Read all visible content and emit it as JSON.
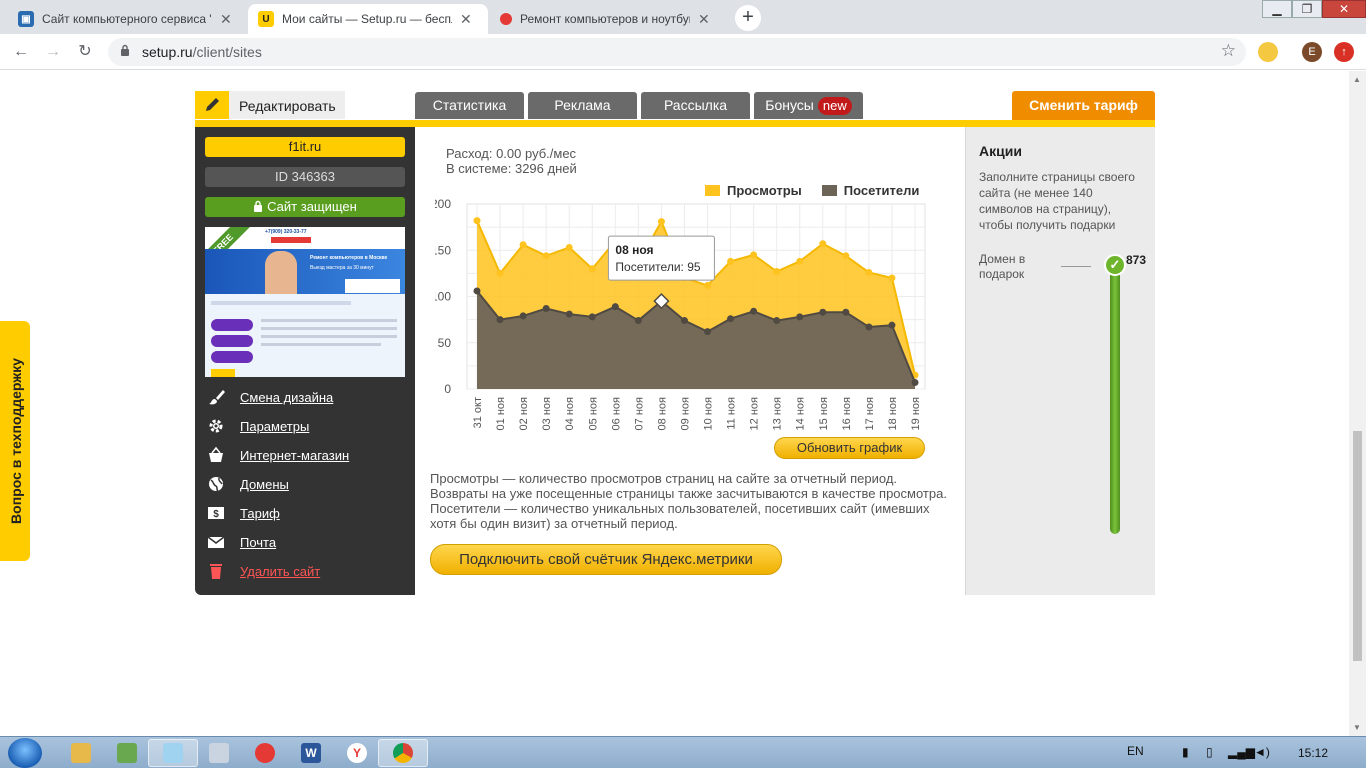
{
  "browser": {
    "tabs": [
      {
        "title": "Сайт компьютерного сервиса \"F",
        "active": false
      },
      {
        "title": "Мои сайты — Setup.ru — беспл",
        "active": true
      },
      {
        "title": "Ремонт компьютеров и ноутбук",
        "active": false
      }
    ],
    "url_host": "setup.ru",
    "url_path": "/client/sites",
    "profile_initial": "E"
  },
  "support_tab": "Вопрос в техподдержку",
  "topbar": {
    "edit_label": "Редактировать",
    "tabs": [
      "Статистика",
      "Реклама",
      "Рассылка",
      "Бонусы"
    ],
    "new_badge": "new",
    "tariff_button": "Сменить тариф"
  },
  "sidebar": {
    "domain": "f1it.ru",
    "site_id": "ID 346363",
    "secure_label": "Сайт защищен",
    "thumb_badge": "FREE",
    "thumb_phone": "+7(909) 320-33-77",
    "thumb_headline": "Ремонт компьютеров в Москве",
    "thumb_subline": "Выезд мастера за 30 минут",
    "menu": [
      {
        "label": "Смена дизайна",
        "icon": "brush-icon"
      },
      {
        "label": "Параметры",
        "icon": "gear-icon"
      },
      {
        "label": "Интернет-магазин",
        "icon": "basket-icon"
      },
      {
        "label": "Домены",
        "icon": "globe-icon"
      },
      {
        "label": "Тариф",
        "icon": "dollar-icon"
      },
      {
        "label": "Почта",
        "icon": "envelope-icon"
      },
      {
        "label": "Удалить сайт",
        "icon": "trash-icon"
      }
    ]
  },
  "stats": {
    "expense": "Расход: 0.00 руб./мес",
    "in_system": "В системе: 3296 дней",
    "refresh_button": "Обновить график",
    "description": "Просмотры — количество просмотров страниц на сайте за отчетный период. Возвраты на уже посещенные страницы также засчитываются в качестве просмотра. Посетители — количество уникальных пользователей, посетивших сайт (имевших хотя бы один визит) за отчетный период.",
    "metrika_button": "Подключить свой счётчик Яндекс.метрики"
  },
  "chart_data": {
    "type": "area",
    "x": [
      "31 окт",
      "01 ноя",
      "02 ноя",
      "03 ноя",
      "04 ноя",
      "05 ноя",
      "06 ноя",
      "07 ноя",
      "08 ноя",
      "09 ноя",
      "10 ноя",
      "11 ноя",
      "12 ноя",
      "13 ноя",
      "14 ноя",
      "15 ноя",
      "16 ноя",
      "17 ноя",
      "18 ноя",
      "19 ноя"
    ],
    "series": [
      {
        "name": "Просмотры",
        "color": "#ffc31f",
        "values": [
          182,
          125,
          156,
          144,
          153,
          130,
          160,
          137,
          181,
          120,
          112,
          138,
          145,
          127,
          138,
          157,
          144,
          126,
          120,
          15
        ]
      },
      {
        "name": "Посетители",
        "color": "#6d6458",
        "values": [
          106,
          75,
          79,
          87,
          81,
          78,
          89,
          74,
          95,
          74,
          62,
          76,
          84,
          74,
          78,
          83,
          83,
          67,
          69,
          7
        ]
      }
    ],
    "yticks": [
      0,
      50,
      100,
      150,
      200
    ],
    "ylim": [
      0,
      200
    ],
    "grid": true,
    "legend": "top-right",
    "tooltip": {
      "title": "08 ноя",
      "label": "Посетители",
      "value": "95",
      "index": 8
    }
  },
  "promo": {
    "title": "Акции",
    "text": "Заполните страницы своего сайта (не менее 140 символов на страницу), чтобы получить подарки",
    "domain_gift": "Домен в подарок",
    "gauge_value": "873"
  },
  "taskbar": {
    "lang": "EN",
    "time": "15:12"
  }
}
